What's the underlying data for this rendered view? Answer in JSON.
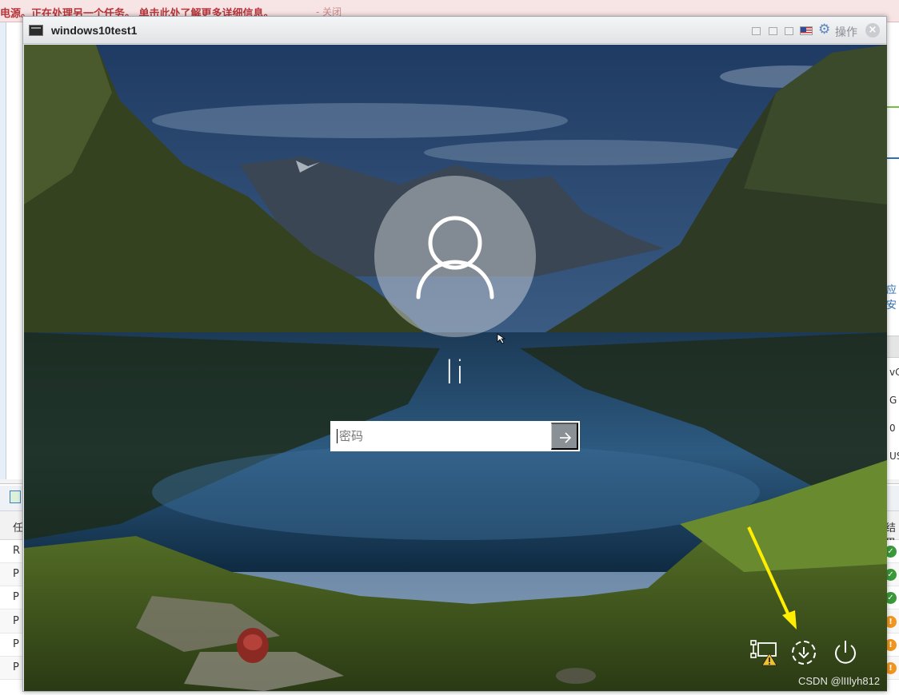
{
  "alert": {
    "message": "电源。正在处理另一个任务。 单击此处了解更多详细信息。",
    "close_label": "- 关闭"
  },
  "background_app": {
    "link_fragment": "应安",
    "right_cells": [
      "vC",
      "G",
      "0",
      "USI"
    ],
    "table_header_fragment": "任",
    "result_header_fragment": "结果",
    "row_letters": [
      "R",
      "P",
      "P",
      "P",
      "P",
      "P"
    ],
    "row_status": [
      "ok",
      "ok",
      "ok",
      "warn",
      "warn",
      "warn"
    ]
  },
  "vm_window": {
    "title": "windows10test1",
    "actions_label": "操作",
    "close_glyph": "×",
    "gear_icon": "gear-icon",
    "flag_icon": "us-flag-icon"
  },
  "lock_screen": {
    "user_name": "li",
    "password_placeholder": "密码",
    "password_value": "",
    "submit_icon": "arrow-right-icon",
    "tray_icons": [
      "network-warning-icon",
      "accessibility-icon",
      "power-icon"
    ]
  },
  "watermark": "CSDN @lIIlyh812",
  "colors": {
    "alert_text": "#b8343a",
    "annotation_arrow": "#ffee00",
    "ok_status": "#3a9a3a",
    "warn_status": "#f0961e"
  }
}
